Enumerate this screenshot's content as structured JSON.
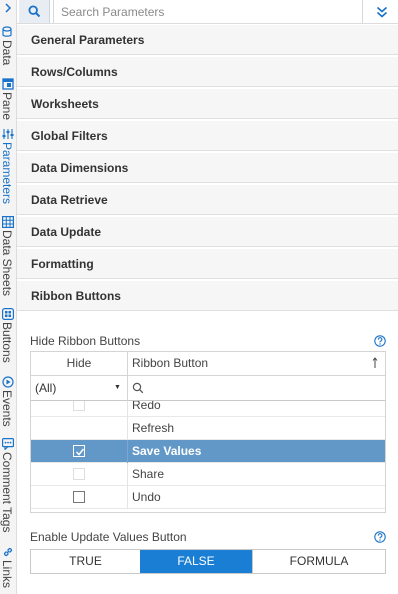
{
  "side_tabs": [
    {
      "label": "Data",
      "icon": "data-icon",
      "active": false
    },
    {
      "label": "Pane",
      "icon": "pane-icon",
      "active": false
    },
    {
      "label": "Parameters",
      "icon": "parameters-icon",
      "active": true
    },
    {
      "label": "Data Sheets",
      "icon": "data-sheets-icon",
      "active": false
    },
    {
      "label": "Buttons",
      "icon": "buttons-icon",
      "active": false
    },
    {
      "label": "Events",
      "icon": "events-icon",
      "active": false
    },
    {
      "label": "Comment Tags",
      "icon": "comment-tags-icon",
      "active": false
    },
    {
      "label": "Links",
      "icon": "links-icon",
      "active": false
    }
  ],
  "search": {
    "placeholder": "Search Parameters"
  },
  "sections": [
    "General Parameters",
    "Rows/Columns",
    "Worksheets",
    "Global Filters",
    "Data Dimensions",
    "Data Retrieve",
    "Data Update",
    "Formatting",
    "Ribbon Buttons"
  ],
  "ribbon": {
    "hide_label": "Hide Ribbon Buttons",
    "grid": {
      "col_hide": "Hide",
      "col_button": "Ribbon Button",
      "filter_value": "(All)",
      "rows": [
        {
          "name": "Redo",
          "hidden": false,
          "selected": false
        },
        {
          "name": "Refresh",
          "hidden": false,
          "selected": false
        },
        {
          "name": "Save Values",
          "hidden": true,
          "selected": true
        },
        {
          "name": "Share",
          "hidden": false,
          "selected": false
        },
        {
          "name": "Undo",
          "hidden": false,
          "selected": false
        }
      ]
    },
    "enable_label": "Enable Update Values Button",
    "options": [
      "TRUE",
      "FALSE",
      "FORMULA"
    ],
    "selected_option": "FALSE"
  },
  "colors": {
    "accent": "#1a7fd4",
    "selected_row": "#6298c7",
    "section_bg": "#f6f6f6"
  }
}
